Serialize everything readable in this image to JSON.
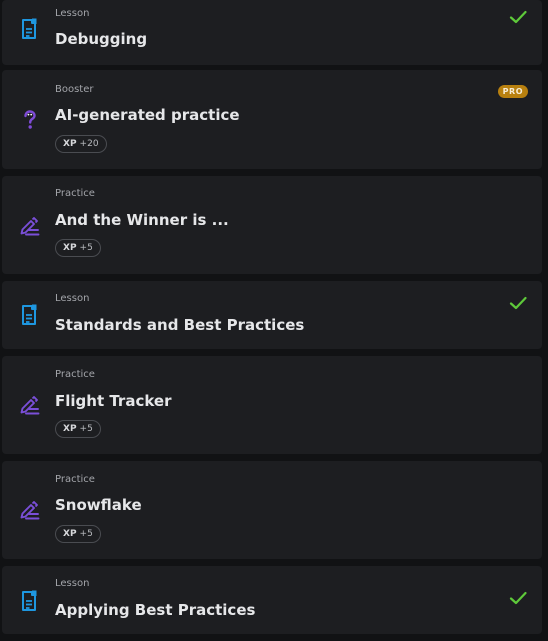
{
  "colors": {
    "lesson_icon": "#1e97e0",
    "practice_icon": "#7a4fd8",
    "booster_icon": "#7e4bd6",
    "check": "#5ec93a",
    "pro_badge": "#b8800f"
  },
  "items": [
    {
      "type": "Lesson",
      "title": "Debugging",
      "icon": "document-icon",
      "completed": true
    },
    {
      "type": "Booster",
      "title": "AI-generated practice",
      "icon": "question-mark-icon",
      "badge": "PRO",
      "xp_label": "XP",
      "xp_value": "+20"
    },
    {
      "type": "Practice",
      "title": "And the Winner is ...",
      "icon": "pencil-lines-icon",
      "xp_label": "XP",
      "xp_value": "+5"
    },
    {
      "type": "Lesson",
      "title": "Standards and Best Practices",
      "icon": "document-icon",
      "completed": true
    },
    {
      "type": "Practice",
      "title": "Flight Tracker",
      "icon": "pencil-lines-icon",
      "xp_label": "XP",
      "xp_value": "+5"
    },
    {
      "type": "Practice",
      "title": "Snowflake",
      "icon": "pencil-lines-icon",
      "xp_label": "XP",
      "xp_value": "+5"
    },
    {
      "type": "Lesson",
      "title": "Applying Best Practices",
      "icon": "document-icon",
      "completed": true
    }
  ]
}
